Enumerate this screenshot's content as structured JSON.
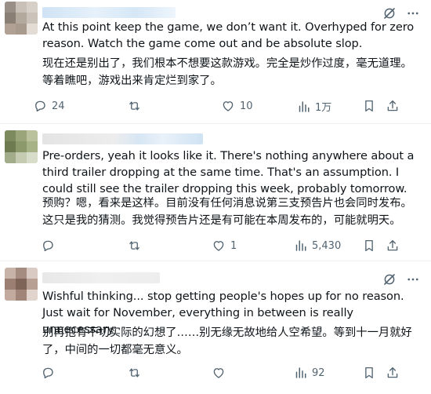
{
  "tweets": [
    {
      "text_en": "At this point keep the game, we don’t want it. Overhyped for zero reason. Watch the game come out and be absolute slop.",
      "text_zh": "现在还是别出了，我们根本不想要这款游戏。完全是炒作过度，毫无道理。等着瞧吧，游戏出来肯定烂到家了。",
      "replies": "24",
      "reposts": "",
      "likes": "10",
      "views": "1万"
    },
    {
      "text_en": "Pre-orders, yeah it looks like it. There's nothing anywhere about a third trailer dropping at the same time. That's an assumption. I could still see the trailer dropping this week, probably tomorrow.",
      "text_zh": "预购？嗯，看来是这样。目前没有任何消息说第三支预告片也会同时发布。这只是我的猜测。我觉得预告片还是有可能在本周发布的，可能就明天。",
      "replies": "",
      "reposts": "",
      "likes": "1",
      "views": "5,430"
    },
    {
      "text_en": "Wishful thinking... stop getting people's hopes up for no reason. Just wait for November, everything in between is really unnecessary",
      "text_zh": "别再抱有不切实际的幻想了……别无缘无故地给人空希望。等到十一月就好了，中间的一切都毫无意义。",
      "replies": "",
      "reposts": "",
      "likes": "",
      "views": "92"
    }
  ],
  "icons": {
    "header": [
      "grok-icon",
      "more-icon"
    ],
    "actions": [
      "reply-icon",
      "repost-icon",
      "like-icon",
      "views-icon",
      "bookmark-icon",
      "share-icon"
    ]
  },
  "colors": {
    "text": "#0f1419",
    "muted": "#536471",
    "divider": "#eff3f4"
  }
}
